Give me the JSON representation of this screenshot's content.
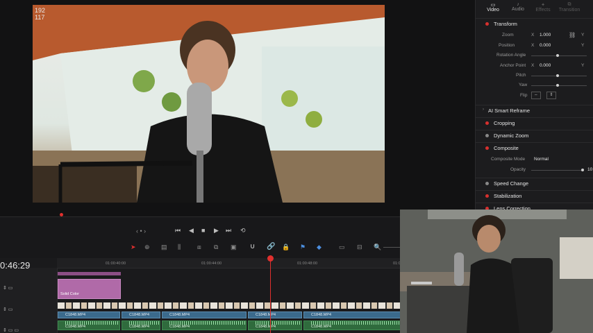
{
  "viewer": {
    "frame_counter": [
      "192",
      "117"
    ]
  },
  "inspector": {
    "tabs": [
      {
        "label": "Video",
        "active": true
      },
      {
        "label": "Audio",
        "active": false
      },
      {
        "label": "Effects",
        "active": false
      },
      {
        "label": "Transition",
        "active": false
      }
    ],
    "transform": {
      "title": "Transform",
      "zoom_label": "Zoom",
      "zoom_x_axis": "X",
      "zoom_x": "1.000",
      "zoom_y_axis": "Y",
      "position_label": "Position",
      "position_x_axis": "X",
      "position_x": "0.000",
      "position_y_axis": "Y",
      "rotation_label": "Rotation Angle",
      "anchor_label": "Anchor Point",
      "anchor_x_axis": "X",
      "anchor_x": "0.000",
      "anchor_y_axis": "Y",
      "pitch_label": "Pitch",
      "yaw_label": "Yaw",
      "flip_label": "Flip"
    },
    "smart_reframe": "AI Smart Reframe",
    "cropping": "Cropping",
    "dynamic_zoom": "Dynamic Zoom",
    "composite": {
      "title": "Composite",
      "mode_label": "Composite Mode",
      "mode_value": "Normal",
      "opacity_label": "Opacity",
      "opacity_value": "10"
    },
    "speed_change": "Speed Change",
    "stabilization": "Stabilization",
    "lens_correction": "Lens Correction"
  },
  "timeline": {
    "timecode": "0:46:29",
    "ruler": [
      "01:00:40:00",
      "01:00:44:00",
      "01:00:48:00",
      "01:00"
    ],
    "solid_color_clip": "Solid Color",
    "video_clip_name": "C1848.MP4",
    "audio_clip_name": "C1848.MP4"
  },
  "colors": {
    "accent_red": "#e0302e",
    "video_clip": "#3b6a8c",
    "audio_clip": "#2f6b3d",
    "solid_color_clip": "#b06aa8"
  }
}
